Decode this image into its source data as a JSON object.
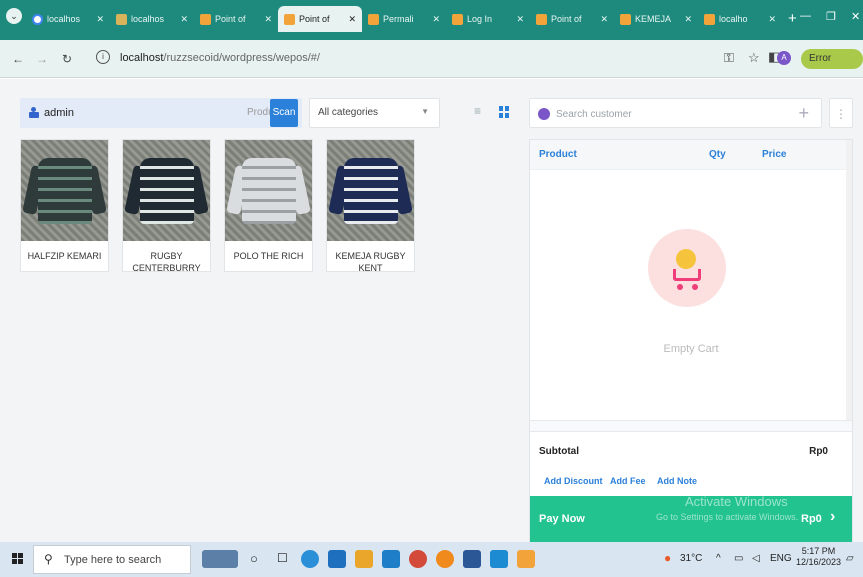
{
  "browser": {
    "tabs": [
      {
        "title": "localhos",
        "favicon": "g"
      },
      {
        "title": "localhos",
        "favicon": "w"
      },
      {
        "title": "Point of",
        "favicon": "x"
      },
      {
        "title": "Point of",
        "favicon": "x",
        "active": true
      },
      {
        "title": "Permali",
        "favicon": "x"
      },
      {
        "title": "Log In",
        "favicon": "x"
      },
      {
        "title": "Point of",
        "favicon": "x"
      },
      {
        "title": "KEMEJA",
        "favicon": "x"
      },
      {
        "title": "localho",
        "favicon": "x"
      }
    ],
    "new_tab": "+",
    "url_host": "localhost",
    "url_path": "/ruzzsecoid/wordpress/wepos/#/",
    "profile_initial": "A",
    "error_label": "Error"
  },
  "pos": {
    "user": "admin",
    "product_label": "Product",
    "scan_label": "Scan",
    "category": "All categories",
    "customer_placeholder": "Search customer",
    "products": [
      {
        "name": "HALFZIP KEMARI",
        "colors": [
          "#2f3a3a",
          "#6a8a7e"
        ]
      },
      {
        "name": "RUGBY CENTERBURRY",
        "colors": [
          "#1f2a33",
          "#dfe6e4"
        ]
      },
      {
        "name": "POLO THE RICH",
        "colors": [
          "#d9dde0",
          "#9aa0a4"
        ]
      },
      {
        "name": "KEMEJA RUGBY KENT",
        "colors": [
          "#1d2b55",
          "#e8ecef"
        ]
      }
    ],
    "cart": {
      "col_product": "Product",
      "col_qty": "Qty",
      "col_price": "Price",
      "empty_text": "Empty Cart",
      "subtotal_label": "Subtotal",
      "subtotal_value": "Rp0",
      "actions": [
        "Add Discount",
        "Add Fee",
        "Add Note"
      ],
      "pay_label": "Pay Now",
      "pay_value": "Rp0"
    },
    "watermark": {
      "title": "Activate Windows",
      "subtitle": "Go to Settings to activate Windows."
    }
  },
  "taskbar": {
    "search_placeholder": "Type here to search",
    "temperature": "31°C",
    "language": "ENG",
    "time": "5:17 PM",
    "date": "12/16/2023"
  },
  "colors": {
    "tabstrip": "#1e8a7e",
    "accent": "#2b80d9",
    "pay": "#22c38e"
  }
}
